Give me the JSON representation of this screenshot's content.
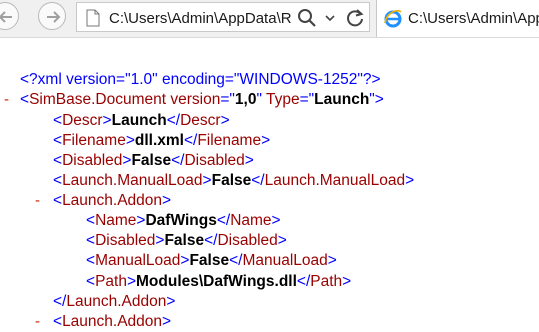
{
  "toolbar": {
    "address": "C:\\Users\\Admin\\AppData\\R",
    "tab_title": "C:\\Users\\Admin\\App"
  },
  "icons": {
    "back": "back-arrow-icon",
    "forward": "forward-arrow-icon",
    "page": "page-icon",
    "search": "search-icon",
    "dropdown": "chevron-down-icon",
    "refresh": "refresh-icon",
    "ie": "ie-logo-icon"
  },
  "colors": {
    "bracket": "#0000ff",
    "tag": "#990000",
    "collapse": "#cc2200"
  },
  "xml": {
    "collapse_symbol": "-",
    "declaration": "<?xml version=\"1.0\" encoding=\"WINDOWS-1252\"?>",
    "root_tag": "SimBase.Document",
    "root_attr1_name": "version",
    "root_attr1_value": "1,0",
    "root_attr2_name": "Type",
    "root_attr2_value": "Launch",
    "descr_tag": "Descr",
    "descr_value": "Launch",
    "filename_tag": "Filename",
    "filename_value": "dll.xml",
    "disabled_tag": "Disabled",
    "disabled_value": "False",
    "manualload_tag": "Launch.ManualLoad",
    "manualload_value": "False",
    "addon_tag": "Launch.Addon",
    "name_tag": "Name",
    "name_value": "DafWings",
    "addon_disabled_tag": "Disabled",
    "addon_disabled_value": "False",
    "addon_manualload_tag": "ManualLoad",
    "addon_manualload_value": "False",
    "path_tag": "Path",
    "path_value": "Modules\\DafWings.dll"
  }
}
